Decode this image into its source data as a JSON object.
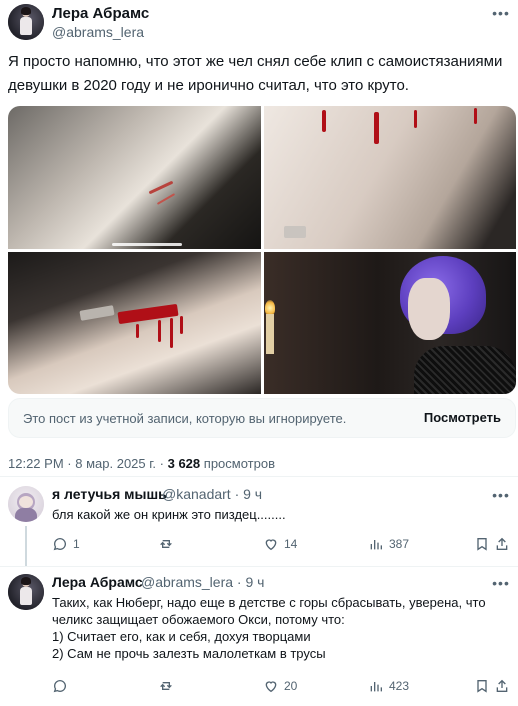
{
  "post": {
    "author_name": "Лера Абрамс",
    "author_handle": "@abrams_lera",
    "text": "Я просто напомню, что этот же чел снял себе клип с самоистязаниями девушки в 2020 году и не иронично считал, что это круто.",
    "more_icon": "more-horizontal-icon",
    "media_count": 4,
    "ignored_notice": "Это пост из учетной записи, которую вы игнорируете.",
    "view_button": "Посмотреть",
    "time": "12:22 PM",
    "dot": "·",
    "date": "8 мар. 2025 г.",
    "views_count": "3 628",
    "views_label": "просмотров"
  },
  "replies": [
    {
      "author_name": "я летучья мышь",
      "author_handle": "@kanadart · 9 ч",
      "text": "бля какой же он кринж это пиздец........",
      "stats": {
        "replies": "1",
        "retweets": "",
        "likes": "14",
        "views": "387"
      }
    },
    {
      "author_name": "Лера Абрамс",
      "author_handle": "@abrams_lera · 9 ч",
      "text": "Таких, как Нюберг, надо еще в детстве с горы сбрасывать, уверена, что\nчеликс защищает обожаемого Окси, потому что:\n1) Считает его, как и себя, дохуя творцами\n2) Сам не прочь залезть малолеткам в трусы",
      "stats": {
        "replies": "",
        "retweets": "",
        "likes": "20",
        "views": "423"
      }
    }
  ],
  "colors": {
    "text_primary": "#0f1419",
    "text_secondary": "#536471",
    "divider": "#eff3f4",
    "notice_bg": "#f7f9f9",
    "blood": "#b00f17"
  }
}
